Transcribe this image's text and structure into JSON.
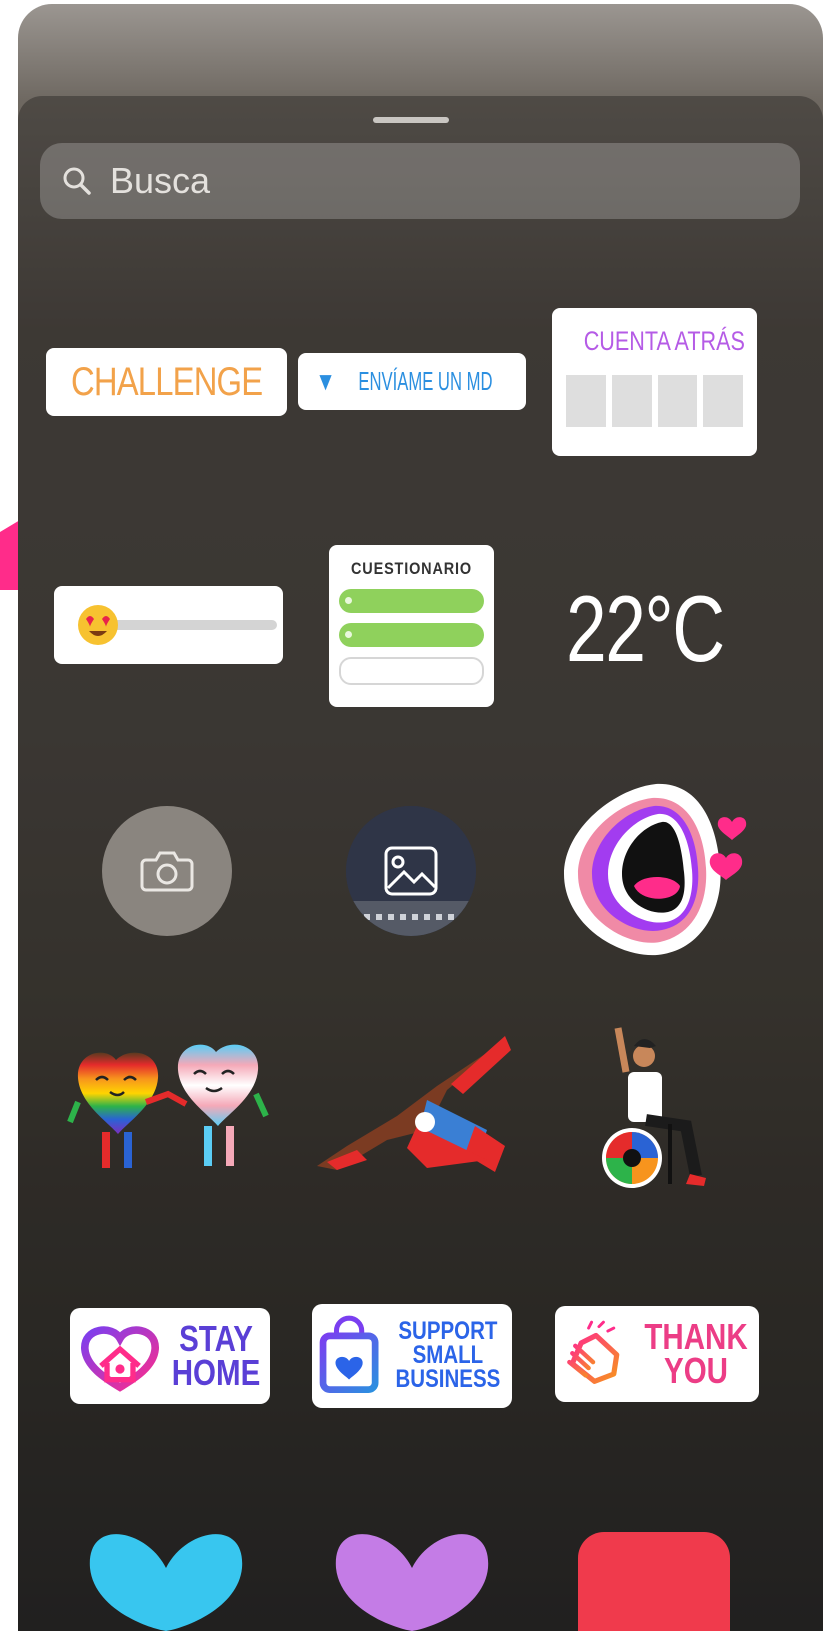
{
  "search": {
    "placeholder": "Busca"
  },
  "stickers": {
    "challenge_label": "CHALLENGE",
    "send_question_label": "ENVÍAME UN MD",
    "countdown_label": "CUENTA ATRÁS",
    "quiz_label": "CUESTIONARIO",
    "temperature_label": "22°C",
    "stay_home_line1": "STAY",
    "stay_home_line2": "HOME",
    "support_line1": "SUPPORT",
    "support_line2": "SMALL",
    "support_line3": "BUSINESS",
    "thank_you_line1": "THANK",
    "thank_you_line2": "YOU"
  },
  "icons": [
    "search-icon",
    "camera-icon",
    "image-icon",
    "emoji-heart-eyes-icon"
  ],
  "colors": {
    "sheet_dark": "#2c2a25",
    "challenge_orange": "#f2a24a",
    "question_blue": "#2b8fe0",
    "countdown_purple": "#b55be6",
    "quiz_green": "#8fd15c",
    "pink_accent": "#ff2c8a"
  }
}
